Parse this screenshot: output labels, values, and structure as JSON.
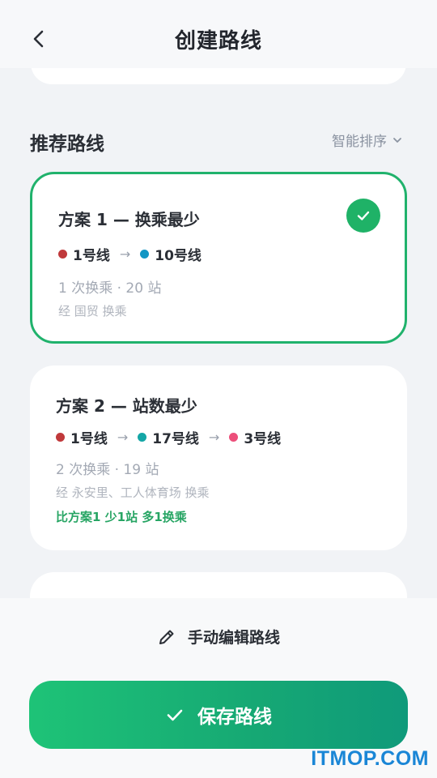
{
  "header": {
    "title": "创建路线"
  },
  "section": {
    "title": "推荐路线",
    "sort_label": "智能排序"
  },
  "routes": [
    {
      "title": "方案 1 — 换乘最少",
      "selected": true,
      "lines": [
        {
          "name": "1号线",
          "color": "#c0393b"
        },
        {
          "name": "10号线",
          "color": "#1296c4"
        }
      ],
      "stats": "1 次换乘 · 20 站",
      "via": "经 国贸 换乘"
    },
    {
      "title": "方案 2 — 站数最少",
      "selected": false,
      "lines": [
        {
          "name": "1号线",
          "color": "#c0393b"
        },
        {
          "name": "17号线",
          "color": "#14a6a6"
        },
        {
          "name": "3号线",
          "color": "#ec4f7a"
        }
      ],
      "stats": "2 次换乘 · 19 站",
      "via": "经 永安里、工人体育场 换乘",
      "compare": "比方案1 少1站 多1换乘"
    }
  ],
  "actions": {
    "manual_edit_label": "手动编辑路线",
    "save_label": "保存路线"
  },
  "watermark": "ITMOP.COM",
  "colors": {
    "accent": "#1fb267",
    "selected_border": "#20b26c",
    "compare_text": "#27a564"
  }
}
